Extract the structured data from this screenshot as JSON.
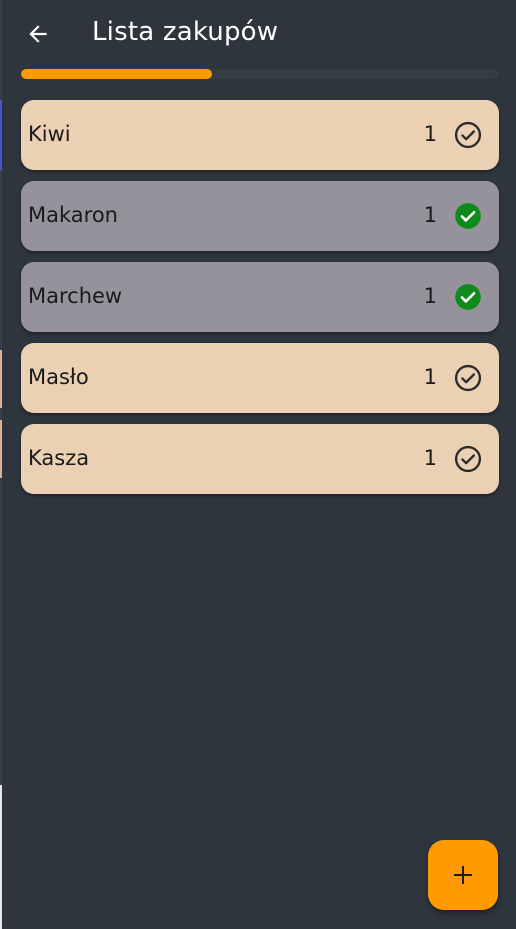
{
  "app": {
    "title": "Lista zakupów"
  },
  "icons": {
    "back": "arrow-left-icon",
    "add": "plus-icon",
    "check_done": "check-circle-filled-icon",
    "check_todo": "check-circle-outline-icon"
  },
  "progress": {
    "fraction": 0.4
  },
  "colors": {
    "background": "#2f353d",
    "accent": "#ff9a00",
    "item_todo_bg": "#ebd0b3",
    "item_done_bg": "#96929c",
    "check_done": "#0f8a1c",
    "check_todo": "#2b2b2b",
    "text_dark": "#1a1a1a",
    "text_light": "#ffffff"
  },
  "items": [
    {
      "name": "Kiwi",
      "quantity": "1",
      "done": false
    },
    {
      "name": "Makaron",
      "quantity": "1",
      "done": true
    },
    {
      "name": "Marchew",
      "quantity": "1",
      "done": true
    },
    {
      "name": "Masło",
      "quantity": "1",
      "done": false
    },
    {
      "name": "Kasza",
      "quantity": "1",
      "done": false
    }
  ]
}
